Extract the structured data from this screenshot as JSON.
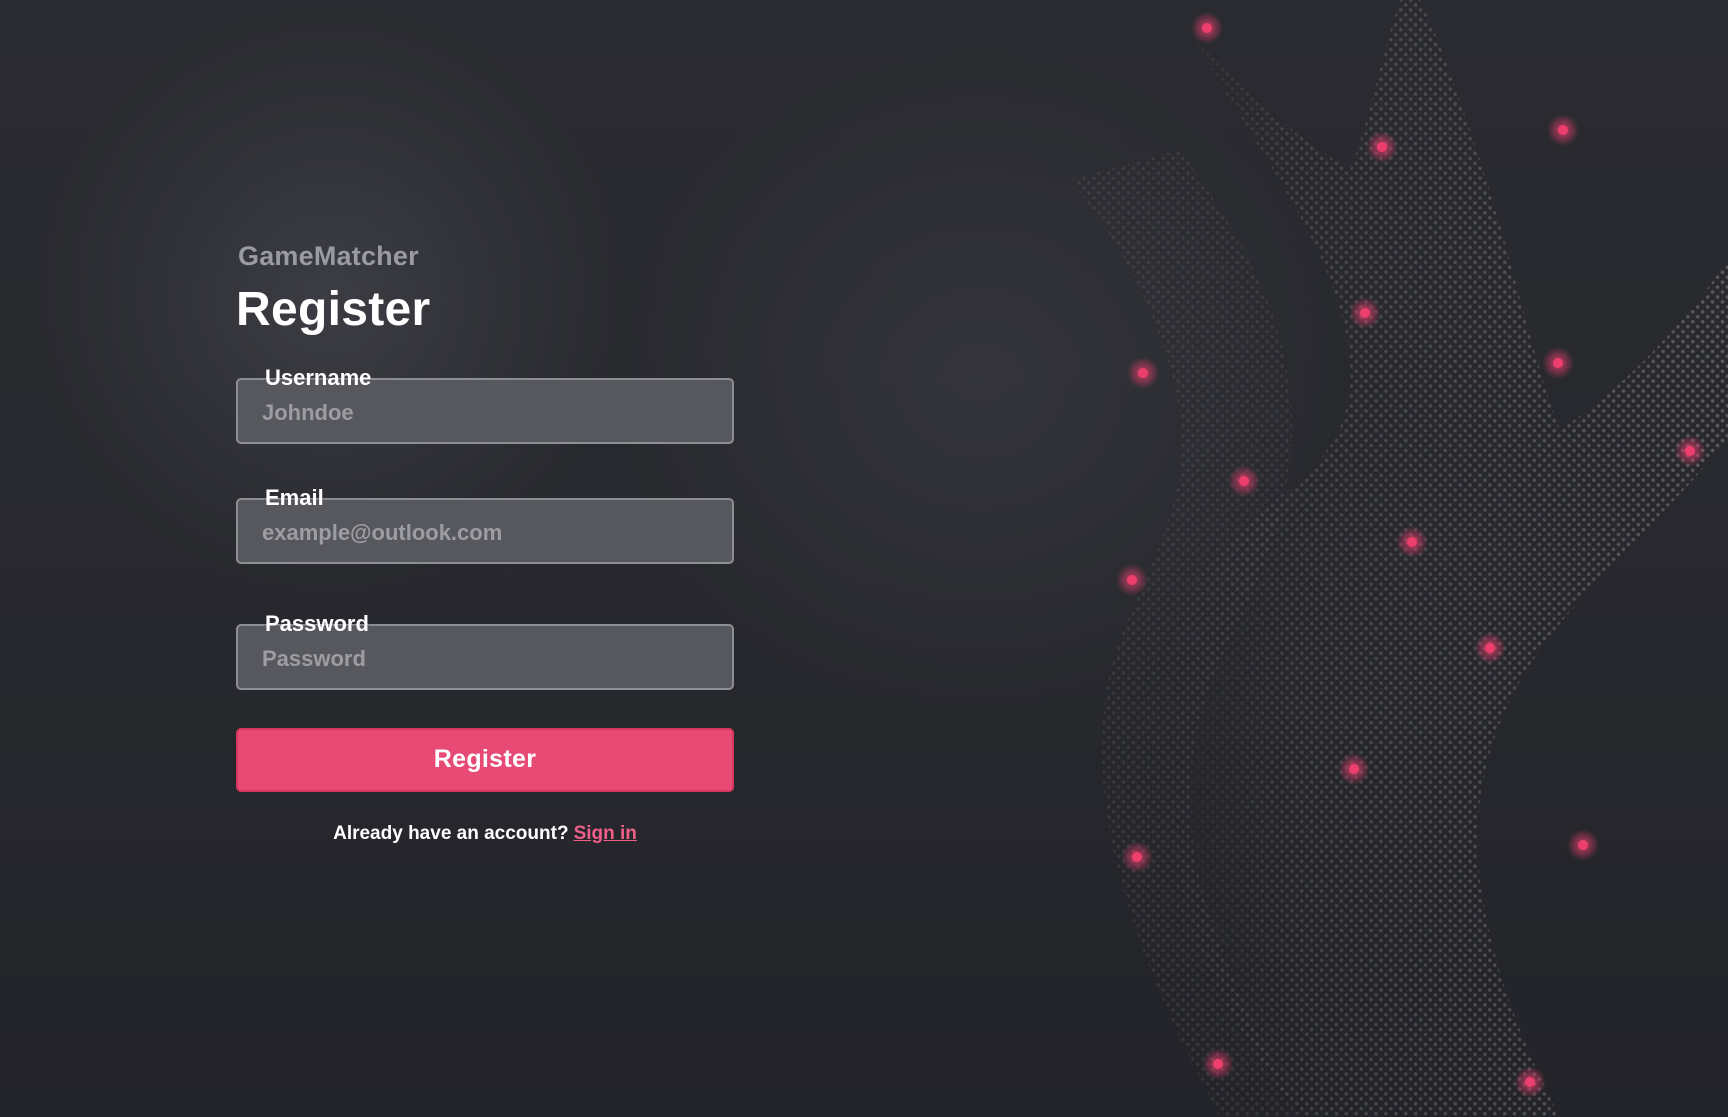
{
  "brand": "GameMatcher",
  "heading": "Register",
  "fields": {
    "username": {
      "label": "Username",
      "placeholder": "Johndoe",
      "value": ""
    },
    "email": {
      "label": "Email",
      "placeholder": "example@outlook.com",
      "value": ""
    },
    "password": {
      "label": "Password",
      "placeholder": "Password",
      "value": ""
    }
  },
  "actions": {
    "register_label": "Register",
    "signin_prompt": "Already have an account?",
    "signin_link": "Sign in"
  },
  "colors": {
    "background": "#28292e",
    "accent": "#e64a75",
    "field_background": "#57585e",
    "field_border": "#8d8e93",
    "link": "#f05f88",
    "dot": "#ec3f6e"
  },
  "decoration": {
    "description_icon": "halftone-wave-with-glowing-dots",
    "dot_count": 20
  }
}
